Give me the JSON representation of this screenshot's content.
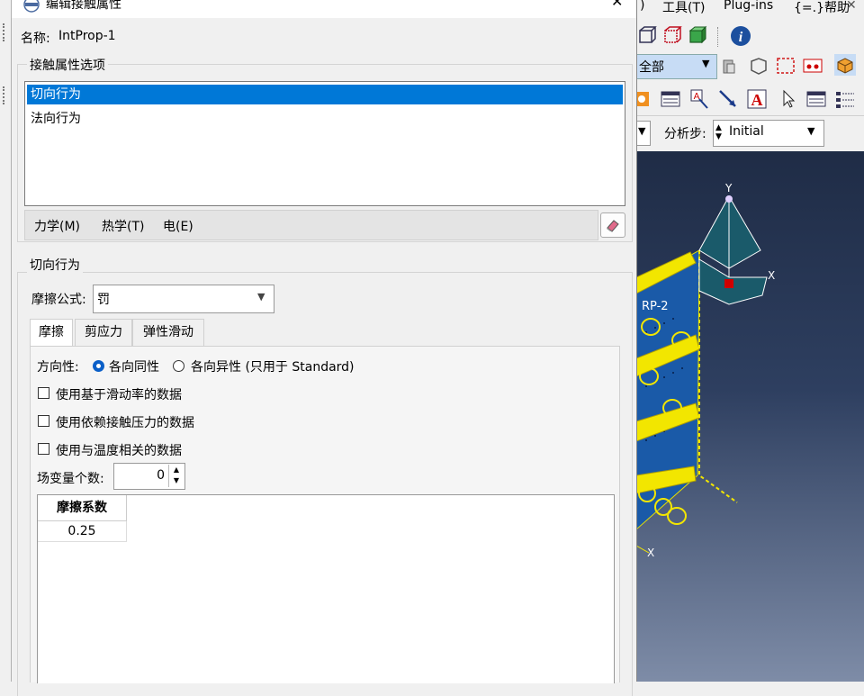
{
  "app": {
    "menu": {
      "tools": "工具(T)",
      "plugins": "Plug-ins",
      "help": "{=.}帮助"
    },
    "selection_combo": "全部",
    "step_label": "分析步:",
    "step_value": "Initial",
    "viewport": {
      "label_rp": "RP-2",
      "axis_y": "Y",
      "axis_x": "X",
      "axis_x_bottom": "X"
    }
  },
  "dialog": {
    "title": "编辑接触属性",
    "close": "✕",
    "name_label": "名称:",
    "name_value": "IntProp-1",
    "options_group": "接触属性选项",
    "options_items": [
      "切向行为",
      "法向行为"
    ],
    "menu": {
      "mechanical": "力学(M)",
      "thermal": "热学(T)",
      "electrical": "电(E)"
    },
    "tangential_group": "切向行为",
    "friction_formula_label": "摩擦公式:",
    "friction_formula_value": "罚",
    "tabs": [
      "摩擦",
      "剪应力",
      "弹性滑动"
    ],
    "directionality_label": "方向性:",
    "radio_isotropic": "各向同性",
    "radio_anisotropic": "各向异性 (只用于 Standard)",
    "check_slip_rate": "使用基于滑动率的数据",
    "check_pressure": "使用依赖接触压力的数据",
    "check_temperature": "使用与温度相关的数据",
    "field_vars_label": "场变量个数:",
    "field_vars_value": "0",
    "table": {
      "header": "摩擦系数",
      "rows": [
        "0.25"
      ]
    }
  }
}
